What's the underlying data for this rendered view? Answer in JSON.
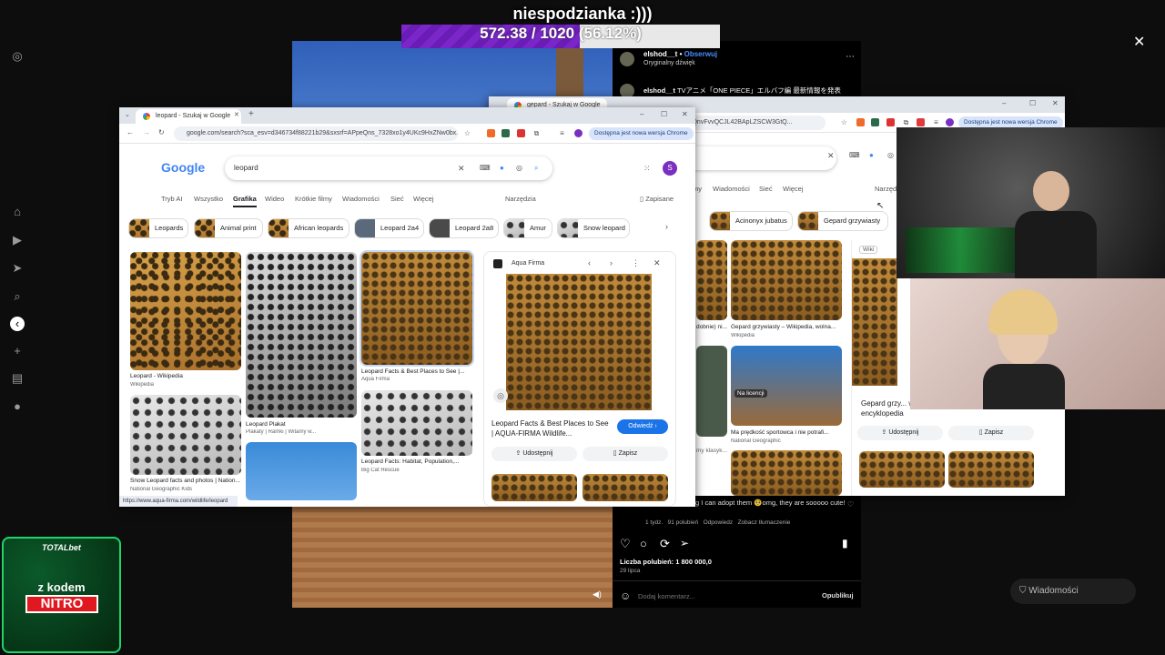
{
  "stream": {
    "title": "niespodzianka :)))",
    "progress_text": "572.38 / 1020 (56.12%)",
    "progress_fraction": 0.5612
  },
  "instagram": {
    "user": "elshod__t",
    "follow": "Obserwuj",
    "audio": "Oryginalny dźwięk",
    "caption_user": "elshod__t",
    "caption": "TVアニメ「ONE PIECE」エルバフ編 最新情報を発表",
    "comment_text": "I will start thinking I can adopt them 🥺omg, they are sooooo cute!",
    "comment_meta": [
      "1 tydz.",
      "91 polubień",
      "Odpowiedz",
      "Zobacz tłumaczenie"
    ],
    "likes": "Liczba polubień: 1 800 000,0",
    "date": "29 lipca",
    "comment_placeholder": "Dodaj komentarz...",
    "publish": "Opublikuj",
    "messages": "Wiadomości",
    "close_icon": "close-icon",
    "accent": "#4a5df9"
  },
  "browser_front": {
    "tab_title": "leopard - Szukaj w Google",
    "url": "google.com/search?sca_esv=d346734f88221b29&sxsrf=APpeQns_7328xo1y4UKc9HxZNw0bx...",
    "new_version": "Dostępna jest nowa wersja Chrome",
    "logo": "Google",
    "query": "leopard",
    "avatar_letter": "S",
    "nav_tabs": [
      "Tryb AI",
      "Wszystko",
      "Grafika",
      "Wideo",
      "Krótkie filmy",
      "Wiadomości",
      "Sieć",
      "Więcej"
    ],
    "tools": "Narzędzia",
    "saved": "Zapisane",
    "chips": [
      "Leopards",
      "Animal print",
      "African leopards",
      "Leopard 2a4",
      "Leopard 2a8",
      "Amur",
      "Snow leopard"
    ],
    "results": [
      {
        "caption": "Leopard - Wikipedia",
        "source": "Wikipedia"
      },
      {
        "caption": "Leopard Plakat",
        "source": "Plakaty | Ramki | Witamy w..."
      },
      {
        "caption": "Leopard Facts & Best Places to See |...",
        "source": "Aqua Firma"
      },
      {
        "caption": "Snow Leopard facts and photos | Nation...",
        "source": "National Geographic Kids"
      },
      {
        "caption": "Leopard Facts: Habitat, Population,...",
        "source": "Big Cat Rescue"
      }
    ],
    "preview": {
      "site": "Aqua Firma",
      "title": "Leopard Facts & Best Places to See | AQUA-FIRMA Wildlife...",
      "visit": "Odwiedź",
      "share": "Udostępnij",
      "save": "Zapisz"
    },
    "status_url": "https://www.aqua-firma.com/wildlife/leopard"
  },
  "browser_back": {
    "tab_title": "gepard - Szukaj w Google",
    "url": "csxsrf=APpeQnvFvvQCJL42BApLZSCW3GtQ...",
    "new_version": "Dostępna jest nowa wersja Chrome",
    "nav_tabs": [
      "my",
      "Wiadomości",
      "Sieć",
      "Więcej"
    ],
    "tools": "Narzęd",
    "chips": [
      "Acinonyx jubatus",
      "Gepard grzywiasty"
    ],
    "results": [
      {
        "caption": "Gepard grzywiasty – Wikipedia, wolna...",
        "source": "Wikipedia"
      },
      {
        "caption": "Na licencji",
        "source": ""
      },
      {
        "caption": "Ma prędkość sportowca i nie potrafi...",
        "source": "National Geographic"
      },
      {
        "caption": "dobnie) ni...",
        "source": ""
      },
      {
        "caption": "my klasyk...",
        "source": ""
      }
    ],
    "preview": {
      "site_badge": "Wiki",
      "title": "Gepard grzy... wolna encyklopedia",
      "share": "Udostępnij",
      "save": "Zapisz"
    }
  },
  "ad": {
    "brand": "TOTALbet",
    "line1": "z kodem",
    "code": "NITRO"
  }
}
